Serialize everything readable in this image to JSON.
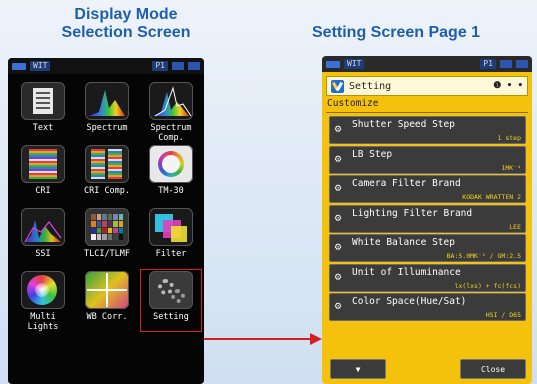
{
  "captions": {
    "left": "Display Mode\nSelection Screen",
    "right": "Setting Screen  Page 1"
  },
  "colors": {
    "caption_blue": "#1f5faa",
    "setting_yellow": "#f4c20d",
    "highlight_red": "#d31f1f",
    "value_yellow": "#f3d21a"
  },
  "left_screen": {
    "status_text": "WIT",
    "status_text_2": "P1",
    "modes": [
      {
        "label": "Text",
        "icon": "text-mode-icon"
      },
      {
        "label": "Spectrum",
        "icon": "spectrum-icon"
      },
      {
        "label": "Spectrum\nComp.",
        "icon": "spectrum-comp-icon"
      },
      {
        "label": "CRI",
        "icon": "cri-icon"
      },
      {
        "label": "CRI Comp.",
        "icon": "cri-comp-icon"
      },
      {
        "label": "TM-30",
        "icon": "tm30-icon"
      },
      {
        "label": "SSI",
        "icon": "ssi-icon"
      },
      {
        "label": "TLCI/TLMF",
        "icon": "tlci-icon"
      },
      {
        "label": "Filter",
        "icon": "filter-icon"
      },
      {
        "label": "Multi\nLights",
        "icon": "multi-lights-icon"
      },
      {
        "label": "WB Corr.",
        "icon": "wb-corr-icon"
      },
      {
        "label": "Setting",
        "icon": "setting-gear-icon"
      }
    ]
  },
  "right_screen": {
    "status_text": "WIT",
    "status_text_2": "P1",
    "header_title": "Setting",
    "page_indicator": "❶ • •",
    "section": "Customize",
    "items": [
      {
        "label": "Shutter Speed Step",
        "value": "1 step"
      },
      {
        "label": "LB Step",
        "value": "1MK⁻¹"
      },
      {
        "label": "Camera Filter Brand",
        "value": "KODAK WRATTEN 2"
      },
      {
        "label": "Lighting Filter Brand",
        "value": "LEE"
      },
      {
        "label": "White Balance Step",
        "value": "BA:5.0MK⁻¹ / GM:2.5"
      },
      {
        "label": "Unit of Illuminance",
        "value": "lx(lxs) + fc(fcs)"
      },
      {
        "label": "Color Space(Hue/Sat)",
        "value": "HSI / D65"
      }
    ],
    "down_button": "▼",
    "close_button": "Close"
  }
}
